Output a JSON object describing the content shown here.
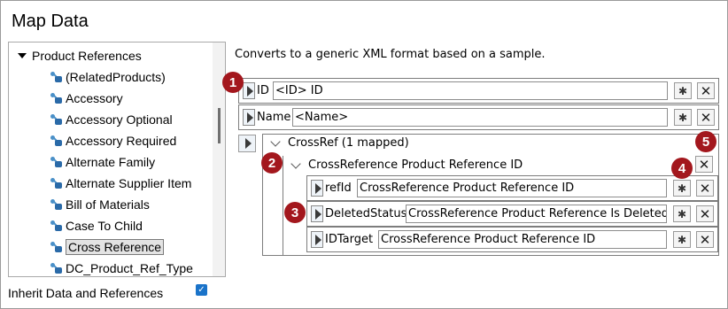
{
  "title": "Map Data",
  "tree": {
    "root_label": "Product References",
    "items": [
      {
        "label": "(RelatedProducts)"
      },
      {
        "label": "Accessory"
      },
      {
        "label": "Accessory Optional"
      },
      {
        "label": "Accessory Required"
      },
      {
        "label": "Alternate Family"
      },
      {
        "label": "Alternate Supplier Item"
      },
      {
        "label": "Bill of Materials"
      },
      {
        "label": "Case To Child"
      },
      {
        "label": "Cross Reference",
        "selected": true
      },
      {
        "label": "DC_Product_Ref_Type"
      }
    ]
  },
  "inherit": {
    "label": "Inherit Data and References",
    "checked": true
  },
  "description": "Converts to a generic XML format based on a sample.",
  "fields": {
    "id": {
      "name": "ID",
      "value": "<ID> ID"
    },
    "name": {
      "name": "Name",
      "value": "<Name>"
    }
  },
  "group": {
    "label": "CrossRef (1 mapped)",
    "sub_label": "CrossReference Product Reference ID",
    "fields": [
      {
        "name": "refId",
        "value": "CrossReference Product Reference ID"
      },
      {
        "name": "DeletedStatus",
        "value": "CrossReference Product Reference Is Deleted"
      },
      {
        "name": "IDTarget",
        "value": "CrossReference Product Reference ID"
      }
    ]
  },
  "badges": [
    "1",
    "2",
    "3",
    "4",
    "5"
  ],
  "icons": {
    "map": "link-map-icon",
    "remove": "close-icon",
    "expand": "play-icon",
    "collapse": "chevron-down-icon",
    "reference": "reference-icon"
  },
  "colors": {
    "badge": "#a3171d",
    "checkbox": "#1a73c9",
    "selection": "#e3e3e3"
  }
}
